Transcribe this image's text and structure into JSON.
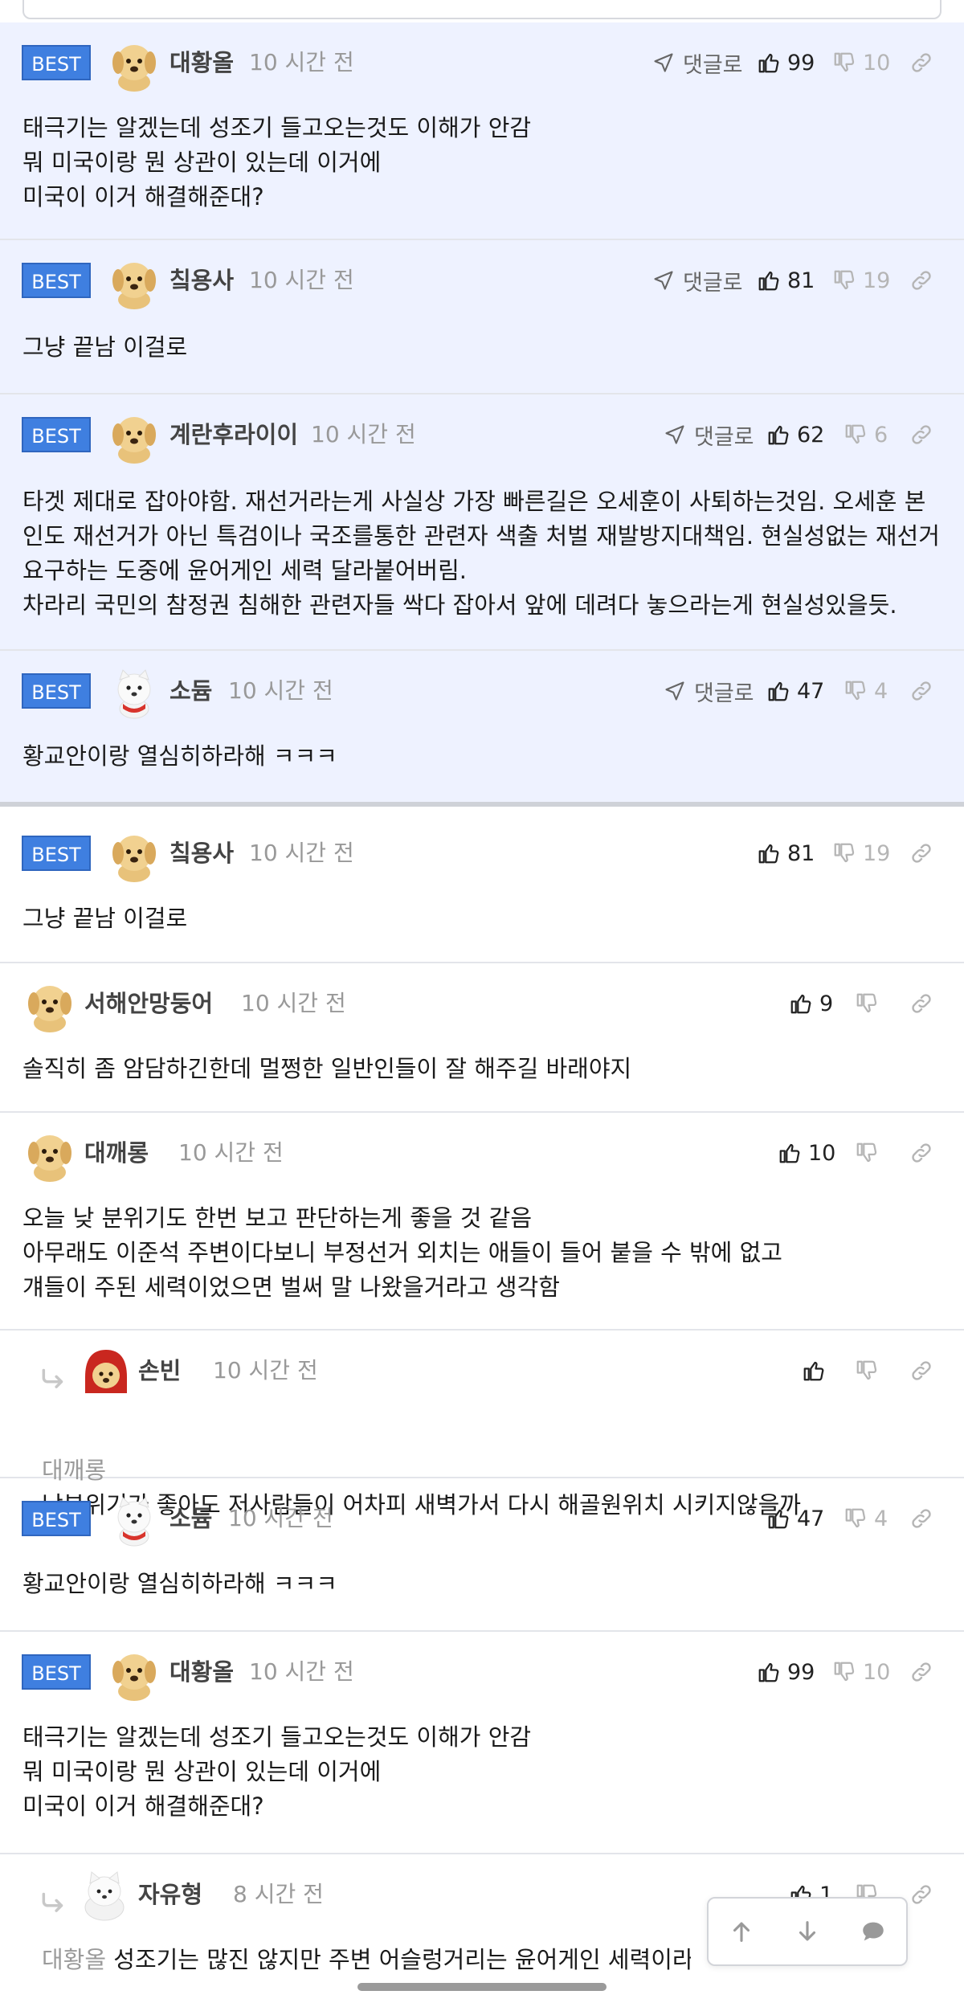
{
  "labels": {
    "best": "BEST",
    "reply_to": "댓글로"
  },
  "colors": {
    "best_badge": "#3f7fe0",
    "best_background": "#eef2ff"
  },
  "best_comments": [
    {
      "nick": "대황올",
      "time": "10 시간 전",
      "likes": "99",
      "dislikes": "10",
      "avatar": "puppy",
      "text": "태극기는 알겠는데 성조기 들고오는것도 이해가 안감\n뭐 미국이랑 뭔 상관이 있는데 이거에\n미국이 이거 해결해준대?"
    },
    {
      "nick": "칰용사",
      "time": "10 시간 전",
      "likes": "81",
      "dislikes": "19",
      "avatar": "puppy",
      "text": "그냥 끝남 이걸로"
    },
    {
      "nick": "계란후라이이",
      "time": "10 시간 전",
      "likes": "62",
      "dislikes": "6",
      "avatar": "puppy",
      "text": "타겟 제대로 잡아야함. 재선거라는게 사실상 가장 빠른길은 오세훈이 사퇴하는것임. 오세훈 본인도 재선거가 아닌 특검이나 국조를통한 관련자 색출 처벌 재발방지대책임. 현실성없는 재선거 요구하는 도중에 윤어게인 세력 달라붙어버림.\n차라리 국민의 참정권 침해한 관련자들 싹다 잡아서 앞에 데려다 놓으라는게 현실성있을듯."
    },
    {
      "nick": "소듐",
      "time": "10 시간 전",
      "likes": "47",
      "dislikes": "4",
      "avatar": "white-dog",
      "text": "황교안이랑 열심히하라해 ㅋㅋㅋ"
    }
  ],
  "comments": [
    {
      "best": true,
      "nick": "칰용사",
      "time": "10 시간 전",
      "likes": "81",
      "dislikes": "19",
      "avatar": "puppy",
      "text": "그냥 끝남 이걸로"
    },
    {
      "best": false,
      "nick": "서해안망둥어",
      "time": "10 시간 전",
      "likes": "9",
      "dislikes": "",
      "avatar": "puppy",
      "text": "솔직히 좀 암담하긴한데 멀쩡한 일반인들이 잘 해주길 바래야지"
    },
    {
      "best": false,
      "nick": "대깨롱",
      "time": "10 시간 전",
      "likes": "10",
      "dislikes": "",
      "avatar": "puppy",
      "text": "오늘 낮 분위기도 한번 보고 판단하는게 좋을 것 같음\n아무래도 이준석 주변이다보니 부정선거 외치는 애들이 들어 붙을 수 밖에 없고\n걔들이 주된 세력이었으면 벌써 말 나왔을거라고 생각함"
    },
    {
      "best": false,
      "reply": true,
      "nick": "손빈",
      "time": "10 시간 전",
      "likes": "",
      "dislikes": "",
      "avatar": "red-hood",
      "target": "대깨롱",
      "text": "낮분위기가 좋아도 저사람들이 어차피 새벽가서 다시 해골원위치 시키지않을까"
    },
    {
      "best": true,
      "nick": "소듐",
      "time": "10 시간 전",
      "likes": "47",
      "dislikes": "4",
      "avatar": "white-dog",
      "text": "황교안이랑 열심히하라해 ㅋㅋㅋ"
    },
    {
      "best": true,
      "nick": "대황올",
      "time": "10 시간 전",
      "likes": "99",
      "dislikes": "10",
      "avatar": "puppy",
      "text": "태극기는 알겠는데 성조기 들고오는것도 이해가 안감\n뭐 미국이랑 뭔 상관이 있는데 이거에\n미국이 이거 해결해준대?"
    },
    {
      "best": false,
      "reply": true,
      "nick": "자유형",
      "time": "8 시간 전",
      "likes": "1",
      "dislikes": "",
      "avatar": "white-fox",
      "target": "대황올",
      "text": "성조기는 많진 않지만 주변 어슬렁거리는 윤어게인 세력이라..."
    }
  ],
  "float_buttons": [
    "scroll-up",
    "scroll-down",
    "comment-write"
  ]
}
